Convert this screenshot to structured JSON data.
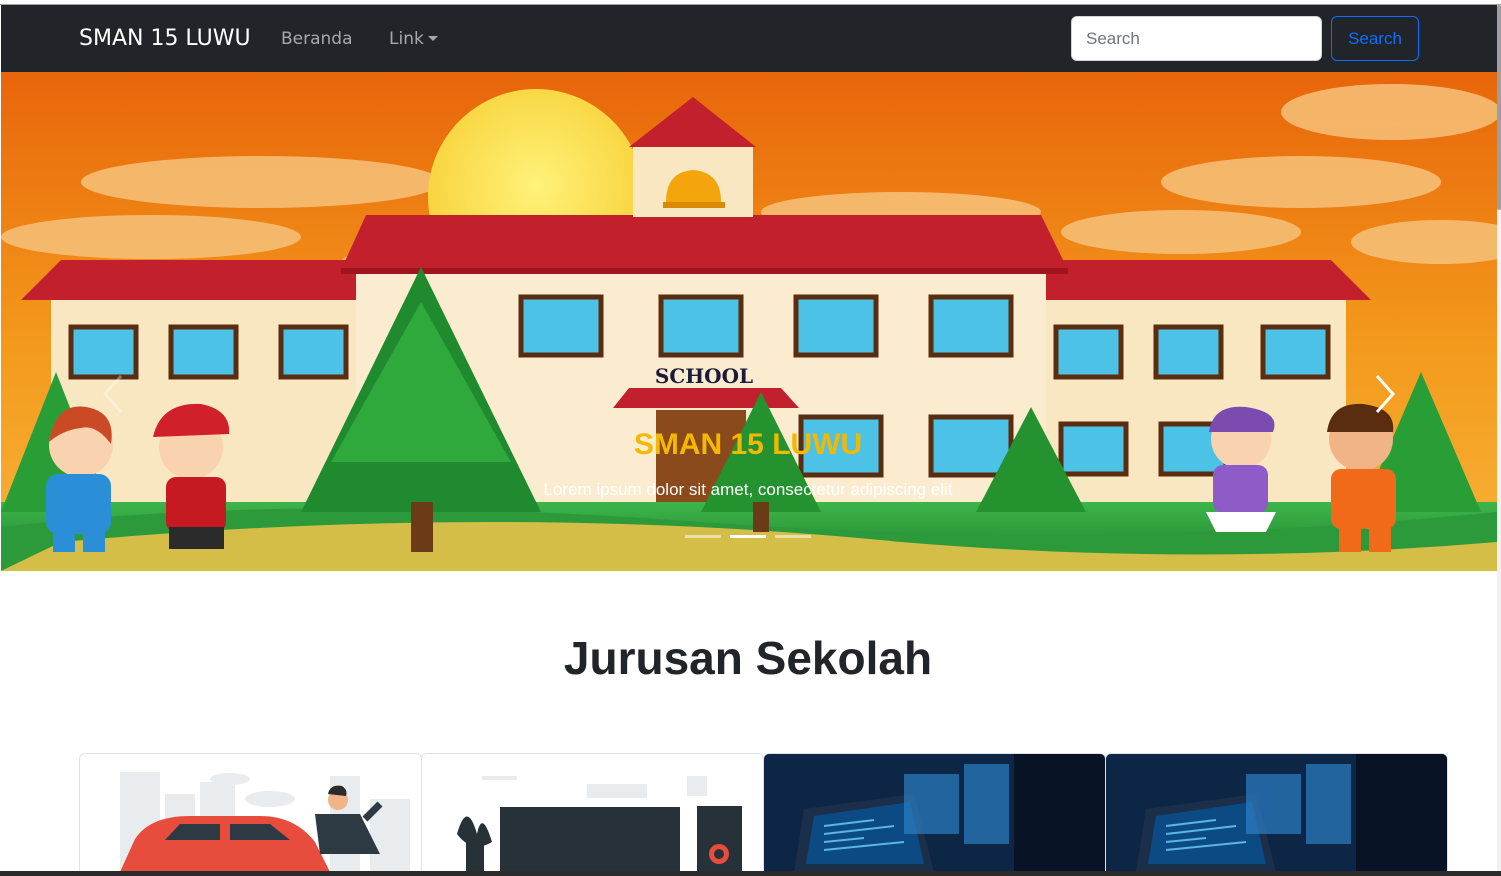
{
  "navbar": {
    "brand": "SMAN 15 LUWU",
    "links": [
      {
        "label": "Beranda"
      },
      {
        "label": "Link",
        "has_dropdown": true
      }
    ],
    "search": {
      "placeholder": "Search",
      "value": "",
      "button_label": "Search"
    }
  },
  "carousel": {
    "slide_text": {
      "sign": "SCHOOL"
    },
    "caption": {
      "title": "SMAN 15 LUWU",
      "text": "Lorem ipsum dolor sit amet, consectetur adipiscing elit"
    },
    "indicators": 3,
    "active_indicator": 2
  },
  "section": {
    "title": "Jurusan Sekolah"
  },
  "colors": {
    "navbar_bg": "#212529",
    "accent_blue": "#0d6efd",
    "caption_title": "#f5b800",
    "sky_orange": "#ee7a10"
  },
  "icons": {
    "prev": "chevron-left-icon",
    "next": "chevron-right-icon",
    "dropdown": "caret-down-icon"
  }
}
